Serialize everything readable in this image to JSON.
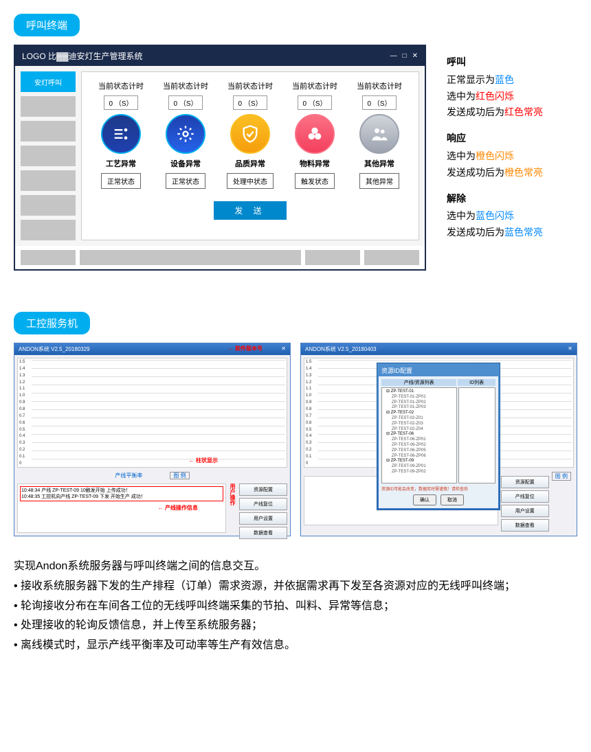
{
  "section1": {
    "badge": "呼叫终端",
    "titlebar": "LOGO  比▓▓迪安灯生产管理系统",
    "sidebar_active": "安灯呼叫",
    "timer_label": "当前状态计时",
    "timer_value": "0  （S）",
    "statuses": [
      {
        "type": "工艺异常",
        "state": "正常状态"
      },
      {
        "type": "设备异常",
        "state": "正常状态"
      },
      {
        "type": "品质异常",
        "state": "处理中状态"
      },
      {
        "type": "物料异常",
        "state": "触发状态"
      },
      {
        "type": "其他异常",
        "state": "其他异常"
      }
    ],
    "send_btn": "发 送",
    "legend": {
      "call_h": "呼叫",
      "call_1a": "正常显示为",
      "call_1b": "蓝色",
      "call_2a": "选中为",
      "call_2b": "红色闪烁",
      "call_3a": "发送成功后为",
      "call_3b": "红色常亮",
      "resp_h": "响应",
      "resp_1a": "选中为",
      "resp_1b": "橙色闪烁",
      "resp_2a": "发送成功后为",
      "resp_2b": "橙色常亮",
      "rel_h": "解除",
      "rel_1a": "选中为",
      "rel_1b": "蓝色闪烁",
      "rel_2a": "发送成功后为",
      "rel_2b": "蓝色常亮"
    }
  },
  "section2": {
    "badge": "工控服务机",
    "win1_title": "ANDON系统 V2.5_20180329",
    "win2_title": "ANDON系统  V2.5_20180403",
    "ver_anno": "软件版本号",
    "bar_anno": "柱状显示",
    "ops_anno": "产线操作信息",
    "user_anno": "用户操作",
    "balance_label": "产线平衡率",
    "legend_btn": "图 例",
    "yaxis": [
      "1.5",
      "1.4",
      "1.3",
      "1.2",
      "1.1",
      "1.0",
      "0.9",
      "0.8",
      "0.7",
      "0.6",
      "0.5",
      "0.4",
      "0.3",
      "0.2",
      "0.1",
      "0"
    ],
    "log1": "10:48:34  产线 ZP-TEST-09 10触发开始 上传成功！",
    "log2": "10:48:35  工控机向产线 ZP-TEST-09 下发 开始生产 成功！",
    "side_ops": [
      "资源配置",
      "产线复位",
      "用户设置",
      "数据查看"
    ],
    "dialog": {
      "title": "资源ID配置",
      "col1": "产线/资源列表",
      "col2": "ID列表",
      "tree": [
        "ZP-TEST-01",
        "  ZP-TEST-01-ZP01",
        "  ZP-TEST-01-ZP02",
        "  ZP-TEST-01-ZP03",
        "ZP-TEST-02",
        "  ZP-TEST-02-Z01",
        "  ZP-TEST-02-Z03",
        "  ZP-TEST-02-Z04",
        "ZP-TEST-06",
        "  ZP-TEST-06-ZP01",
        "  ZP-TEST-06-ZP02",
        "  ZP-TEST-06-ZP05",
        "  ZP-TEST-06-ZP06",
        "ZP-TEST-09",
        "  ZP-TEST-09-ZP01",
        "  ZP-TEST-09-ZP02"
      ],
      "warn": "资源ID可能会改变，数据库时需谨慎！请检查后",
      "ok": "确认",
      "cancel": "取消"
    },
    "desc": {
      "l0": "实现Andon系统服务器与呼叫终端之间的信息交互。",
      "l1": "• 接收系统服务器下发的生产排程（订单）需求资源，并依据需求再下发至各资源对应的无线呼叫终端；",
      "l2": "• 轮询接收分布在车间各工位的无线呼叫终端采集的节拍、叫料、异常等信息；",
      "l3": "• 处理接收的轮询反馈信息，并上传至系统服务器；",
      "l4": "• 离线模式时，显示产线平衡率及可动率等生产有效信息。"
    }
  }
}
